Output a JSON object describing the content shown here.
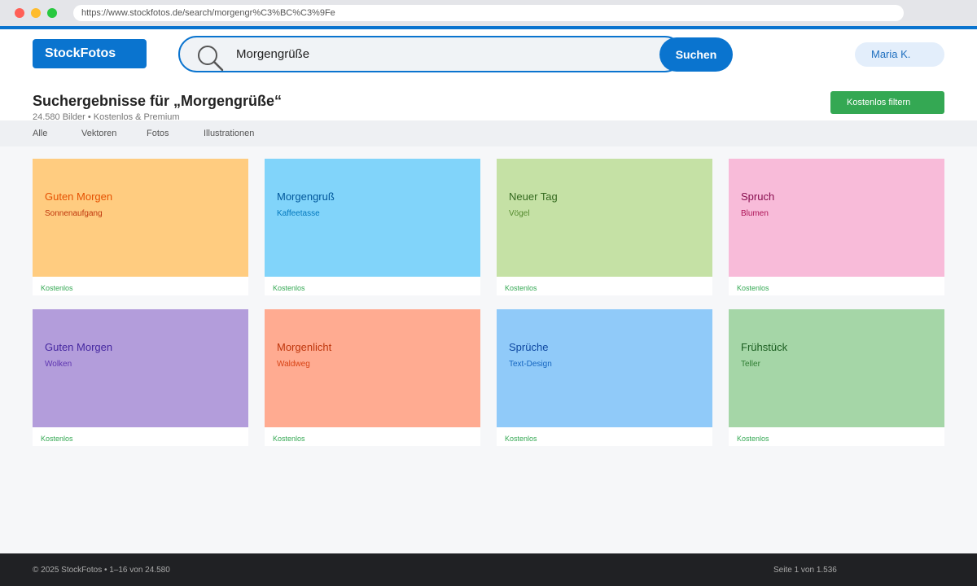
{
  "browser": {
    "url": "https://www.stockfotos.de/search/morgengr%C3%BC%C3%9Fe"
  },
  "header": {
    "logo": "StockFotos",
    "search_value": "Morgengrüße",
    "search_button": "Suchen",
    "user": "Maria K.",
    "title": "Suchergebnisse für „Morgengrüße“",
    "subtitle": "24.580 Bilder • Kostenlos & Premium",
    "filter_button": "Kostenlos filtern"
  },
  "tabs": [
    {
      "label": "Alle"
    },
    {
      "label": "Vektoren"
    },
    {
      "label": "Fotos"
    },
    {
      "label": "Illustrationen"
    }
  ],
  "results": [
    {
      "title": "Guten Morgen",
      "subtitle": "Sonnenaufgang",
      "badge": "Kostenlos",
      "bg": "#ffcc80",
      "title_color": "#e65100",
      "sub_color": "#bf360c"
    },
    {
      "title": "Morgengruß",
      "subtitle": "Kaffeetasse",
      "badge": "Kostenlos",
      "bg": "#81d4fa",
      "title_color": "#01579b",
      "sub_color": "#0277bd"
    },
    {
      "title": "Neuer Tag",
      "subtitle": "Vögel",
      "badge": "Kostenlos",
      "bg": "#c5e1a5",
      "title_color": "#33691e",
      "sub_color": "#558b2f"
    },
    {
      "title": "Spruch",
      "subtitle": "Blumen",
      "badge": "Kostenlos",
      "bg": "#f8bbd9",
      "title_color": "#880e4f",
      "sub_color": "#ad1457"
    },
    {
      "title": "Guten Morgen",
      "subtitle": "Wolken",
      "badge": "Kostenlos",
      "bg": "#b39ddb",
      "title_color": "#4527a0",
      "sub_color": "#5e35b1"
    },
    {
      "title": "Morgenlicht",
      "subtitle": "Waldweg",
      "badge": "Kostenlos",
      "bg": "#ffab91",
      "title_color": "#bf360c",
      "sub_color": "#d84315"
    },
    {
      "title": "Sprüche",
      "subtitle": "Text-Design",
      "badge": "Kostenlos",
      "bg": "#90caf9",
      "title_color": "#0d47a1",
      "sub_color": "#1565c0"
    },
    {
      "title": "Frühstück",
      "subtitle": "Teller",
      "badge": "Kostenlos",
      "bg": "#a5d6a7",
      "title_color": "#1b5e20",
      "sub_color": "#2e7d32"
    }
  ],
  "footer": {
    "left": "© 2025 StockFotos • 1–16 von 24.580",
    "right": "Seite 1 von 1.536"
  },
  "colors": {
    "accent": "#0a74cf",
    "success": "#34a853"
  }
}
